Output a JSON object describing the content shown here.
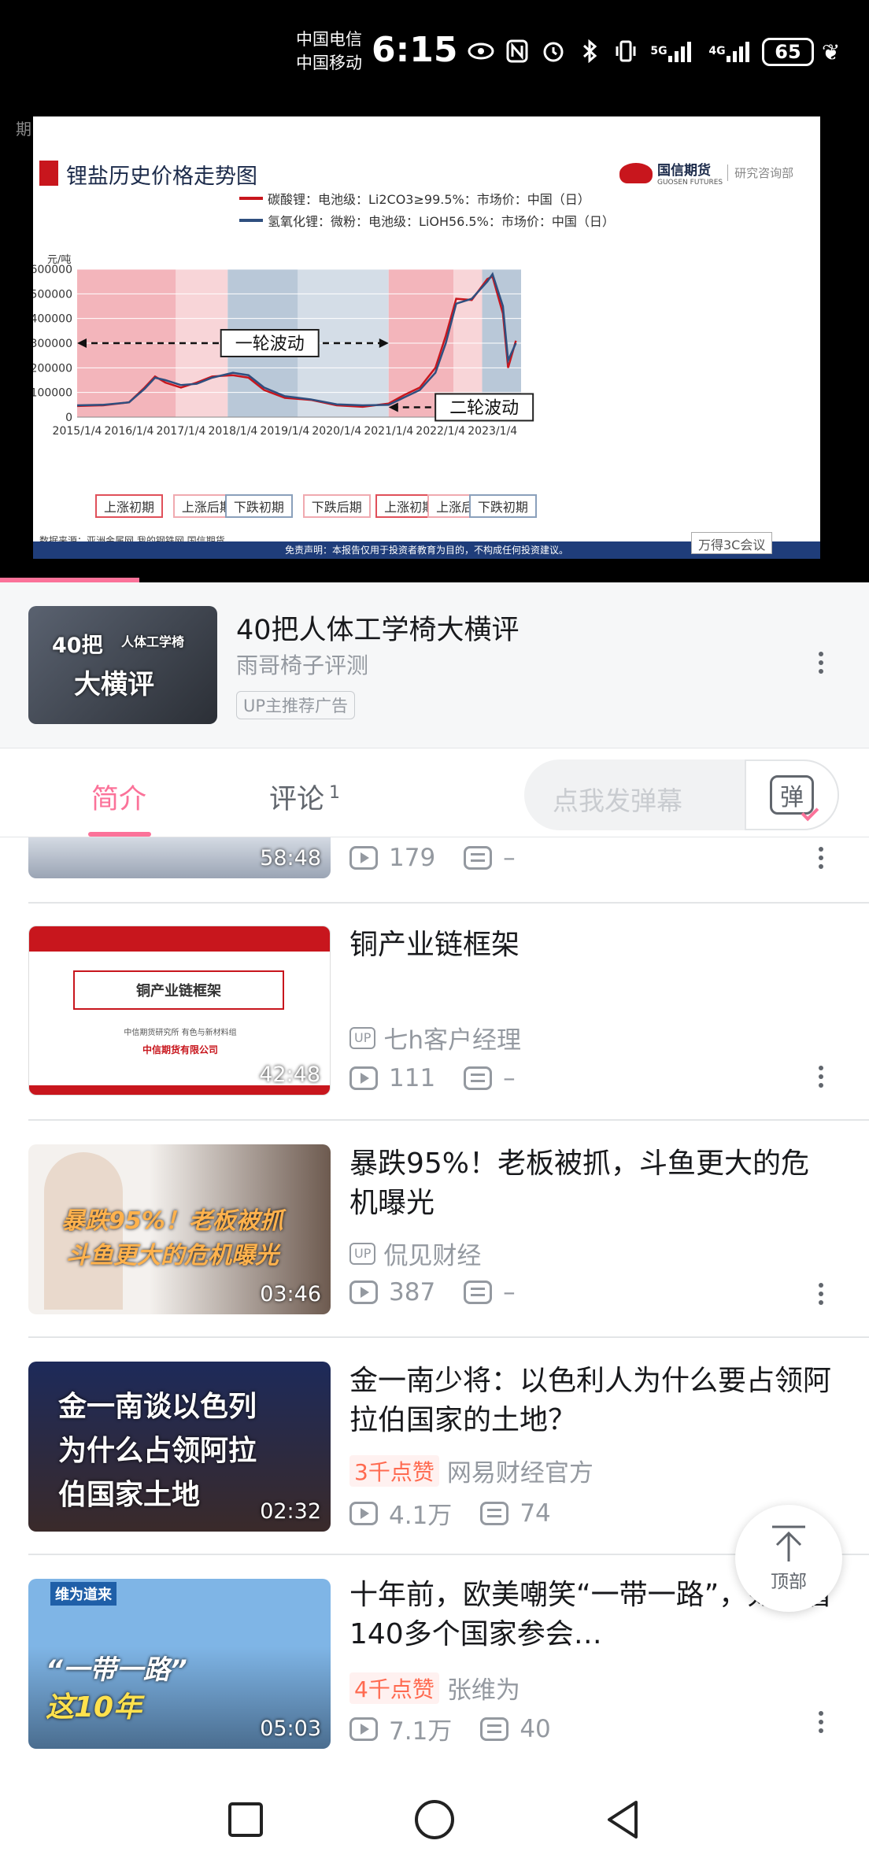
{
  "status_bar": {
    "carrier1": "中国电信",
    "carrier2": "中国移动",
    "time": "6:15",
    "icons": [
      "eye-icon",
      "nfc-icon",
      "alarm-icon",
      "bluetooth-icon",
      "vibrate-icon",
      "signal-5g-icon",
      "signal-4g-icon"
    ],
    "signal_5g_label": "5G",
    "signal_4g_label": "4G",
    "battery": "65"
  },
  "player": {
    "watermark": "期... bilibili",
    "slide": {
      "title": "锂盐历史价格走势图",
      "logo_name": "国信期货",
      "logo_en": "GUOSEN FUTURES",
      "logo_sub": "研究咨询部",
      "source": "数据来源：亚洲金属网 我的钢铁网 国信期货",
      "disclaimer": "免责声明：本报告仅用于投资者教育为目的，不构成任何投资建议。",
      "wind_badge": "万得3C会议"
    },
    "progress": 0.16
  },
  "chart_data": {
    "type": "line",
    "title": "锂盐历史价格走势图",
    "ylabel": "元/吨",
    "ylim": [
      0,
      600000
    ],
    "yticks": [
      "600000",
      "500000",
      "400000",
      "300000",
      "200000",
      "100000",
      "0"
    ],
    "xticks": [
      "2015/1/4",
      "2016/1/4",
      "2017/1/4",
      "2018/1/4",
      "2019/1/4",
      "2020/1/4",
      "2021/1/4",
      "2022/1/4",
      "2023/1/4"
    ],
    "x": [
      2015.0,
      2015.5,
      2016.0,
      2016.3,
      2016.5,
      2016.7,
      2017.0,
      2017.3,
      2017.6,
      2018.0,
      2018.3,
      2018.6,
      2019.0,
      2019.5,
      2020.0,
      2020.5,
      2021.0,
      2021.3,
      2021.6,
      2021.9,
      2022.1,
      2022.3,
      2022.6,
      2022.9,
      2023.0,
      2023.2,
      2023.3,
      2023.45
    ],
    "series": [
      {
        "name": "碳酸锂：电池级：Li2CO3≥99.5%：市场价：中国（日）",
        "color": "#c8161d",
        "values": [
          45000,
          48000,
          60000,
          120000,
          165000,
          140000,
          120000,
          140000,
          165000,
          170000,
          160000,
          110000,
          78000,
          70000,
          48000,
          42000,
          55000,
          90000,
          120000,
          200000,
          330000,
          480000,
          475000,
          560000,
          570000,
          420000,
          200000,
          310000
        ]
      },
      {
        "name": "氢氧化锂：微粉：电池级：LiOH56.5%：市场价：中国（日）",
        "color": "#2f4f7f",
        "values": [
          48000,
          50000,
          60000,
          115000,
          160000,
          150000,
          130000,
          135000,
          160000,
          180000,
          170000,
          120000,
          85000,
          72000,
          52000,
          48000,
          50000,
          80000,
          110000,
          180000,
          300000,
          460000,
          480000,
          550000,
          580000,
          450000,
          230000,
          300000
        ]
      }
    ],
    "annotations": [
      "一轮波动",
      "二轮波动"
    ],
    "phase_labels": [
      "上涨初期",
      "上涨后期",
      "下跌初期",
      "下跌后期",
      "上涨初期",
      "上涨后期",
      "下跌初期"
    ]
  },
  "ad": {
    "thumb_line1": "40把",
    "thumb_line1b": "人体工学椅",
    "thumb_line2": "大横评",
    "title": "40把人体工学椅大横评",
    "author": "雨哥椅子评测",
    "badge": "UP主推荐广告"
  },
  "tabs": {
    "intro": "简介",
    "comments": "评论",
    "comments_count": "1",
    "danmu_placeholder": "点我发弹幕",
    "danmu_button": "弹"
  },
  "videos": [
    {
      "duration": "58:48",
      "title": "",
      "author": "",
      "likes": "",
      "views": "179",
      "danmaku": "–"
    },
    {
      "duration": "42:48",
      "title": "铜产业链框架",
      "author": "七h客户经理",
      "likes": "",
      "views": "111",
      "danmaku": "–",
      "thumb_title": "铜产业链框架",
      "thumb_sub": "中信期货研究所 有色与新材料组",
      "thumb_company": "中信期货有限公司"
    },
    {
      "duration": "03:46",
      "title": "暴跌95%！老板被抓，斗鱼更大的危机曝光",
      "author": "侃见财经",
      "likes": "",
      "views": "387",
      "danmaku": "–",
      "thumb_line1": "暴跌95%！老板被抓",
      "thumb_line2": "斗鱼更大的危机曝光"
    },
    {
      "duration": "02:32",
      "title": "金一南少将：以色利人为什么要占领阿拉伯国家的土地？",
      "author": "网易财经官方",
      "likes": "3千点赞",
      "views": "4.1万",
      "danmaku": "74",
      "thumb_line1": "金一南谈以色列",
      "thumb_line2": "为什么占领阿拉",
      "thumb_line3": "伯国家土地"
    },
    {
      "duration": "05:03",
      "title": "十年前，欧美嘲笑“一带一路”，如今看140多个国家参会…",
      "author": "张维为",
      "likes": "4千点赞",
      "views": "7.1万",
      "danmaku": "40",
      "thumb_tag": "维为道来",
      "thumb_line1": "“一带一路”",
      "thumb_line2": "这10年"
    }
  ],
  "up_label": "UP",
  "top_button": "顶部",
  "nav": [
    "recents-button",
    "home-button",
    "back-button"
  ]
}
